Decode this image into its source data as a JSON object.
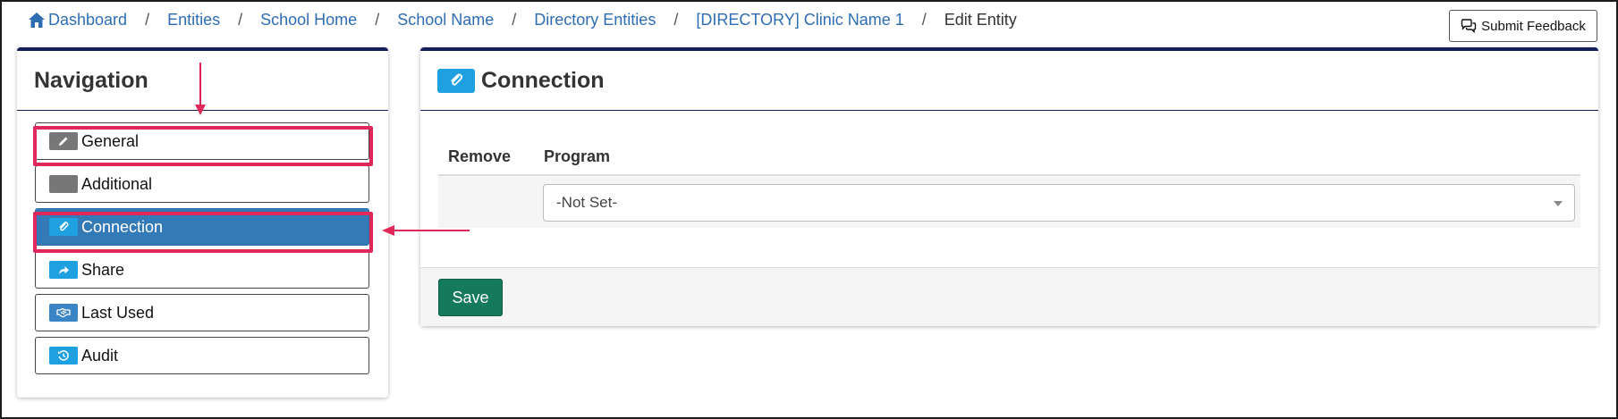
{
  "breadcrumb": {
    "items": [
      "Dashboard",
      "Entities",
      "School Home",
      "School Name",
      "Directory Entities",
      "[DIRECTORY] Clinic Name 1"
    ],
    "current": "Edit Entity",
    "separator": "/"
  },
  "feedback_button": {
    "label": "Submit Feedback"
  },
  "navigation": {
    "title": "Navigation",
    "items": [
      {
        "label": "General",
        "icon": "pencil-icon",
        "active": false
      },
      {
        "label": "Additional",
        "icon": "blank-icon",
        "active": false
      },
      {
        "label": "Connection",
        "icon": "paperclip-icon",
        "active": true
      },
      {
        "label": "Share",
        "icon": "share-arrow-icon",
        "active": false
      },
      {
        "label": "Last Used",
        "icon": "handshake-icon",
        "active": false
      },
      {
        "label": "Audit",
        "icon": "history-icon",
        "active": false
      }
    ]
  },
  "connection": {
    "title": "Connection",
    "columns": {
      "remove": "Remove",
      "program": "Program"
    },
    "program_value": "-Not Set-",
    "save_label": "Save"
  },
  "colors": {
    "accent": "#337ab7",
    "link": "#2f6db3",
    "panel_border": "#15205a",
    "save": "#157a5c",
    "annotation": "#e0285a"
  }
}
